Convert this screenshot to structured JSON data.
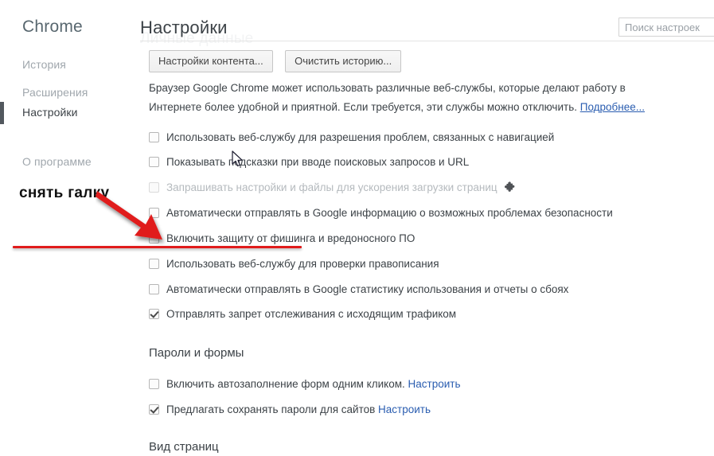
{
  "sidebar": {
    "brand": "Chrome",
    "items": [
      {
        "label": "История",
        "active": false
      },
      {
        "label": "Расширения",
        "active": false
      },
      {
        "label": "Настройки",
        "active": true
      },
      {
        "label": "О программе",
        "active": false
      }
    ]
  },
  "header": {
    "title": "Настройки",
    "ghost_title": "Личные данные",
    "search_placeholder": "Поиск настроек",
    "search_value": ""
  },
  "toolbar": {
    "content_settings_label": "Настройки контента...",
    "clear_history_label": "Очистить историю..."
  },
  "description": {
    "text_before_link": "Браузер Google Chrome может использовать различные веб-службы, которые делают работу в Интернете более удобной и приятной. Если требуется, эти службы можно отключить. ",
    "link_label": "Подробнее..."
  },
  "privacy_checkboxes": [
    {
      "label": "Использовать веб-службу для разрешения проблем, связанных с навигацией",
      "checked": false,
      "disabled": false,
      "icon": null
    },
    {
      "label": "Показывать подсказки при вводе поисковых запросов и URL",
      "checked": false,
      "disabled": false,
      "icon": null
    },
    {
      "label": "Запрашивать настройки и файлы для ускорения загрузки страниц",
      "checked": false,
      "disabled": true,
      "icon": "puzzle-piece-icon"
    },
    {
      "label": "Автоматически отправлять в Google информацию о возможных проблемах безопасности",
      "checked": false,
      "disabled": false,
      "icon": null
    },
    {
      "label": "Включить защиту от фишинга и вредоносного ПО",
      "checked": false,
      "disabled": false,
      "icon": null
    },
    {
      "label": "Использовать веб-службу для проверки правописания",
      "checked": false,
      "disabled": false,
      "icon": null
    },
    {
      "label": "Автоматически отправлять в Google статистику использования и отчеты о сбоях",
      "checked": false,
      "disabled": false,
      "icon": null
    },
    {
      "label": "Отправлять запрет отслеживания с исходящим трафиком",
      "checked": true,
      "disabled": false,
      "icon": null
    }
  ],
  "passwords_section": {
    "heading": "Пароли и формы",
    "rows": [
      {
        "label": "Включить автозаполнение форм одним кликом.",
        "link": "Настроить",
        "checked": false
      },
      {
        "label": "Предлагать сохранять пароли для сайтов",
        "link": "Настроить",
        "checked": true
      }
    ]
  },
  "appearance_section": {
    "heading": "Вид страниц"
  },
  "annotation": {
    "text": "снять галку",
    "arrow_color": "#e01b1b",
    "underline_color": "#e01b1b"
  },
  "colors": {
    "link": "#2a5db0",
    "text": "#3c4247",
    "muted": "#a0a7ad",
    "accent_red": "#e01b1b",
    "active_marker": "#52585e"
  }
}
